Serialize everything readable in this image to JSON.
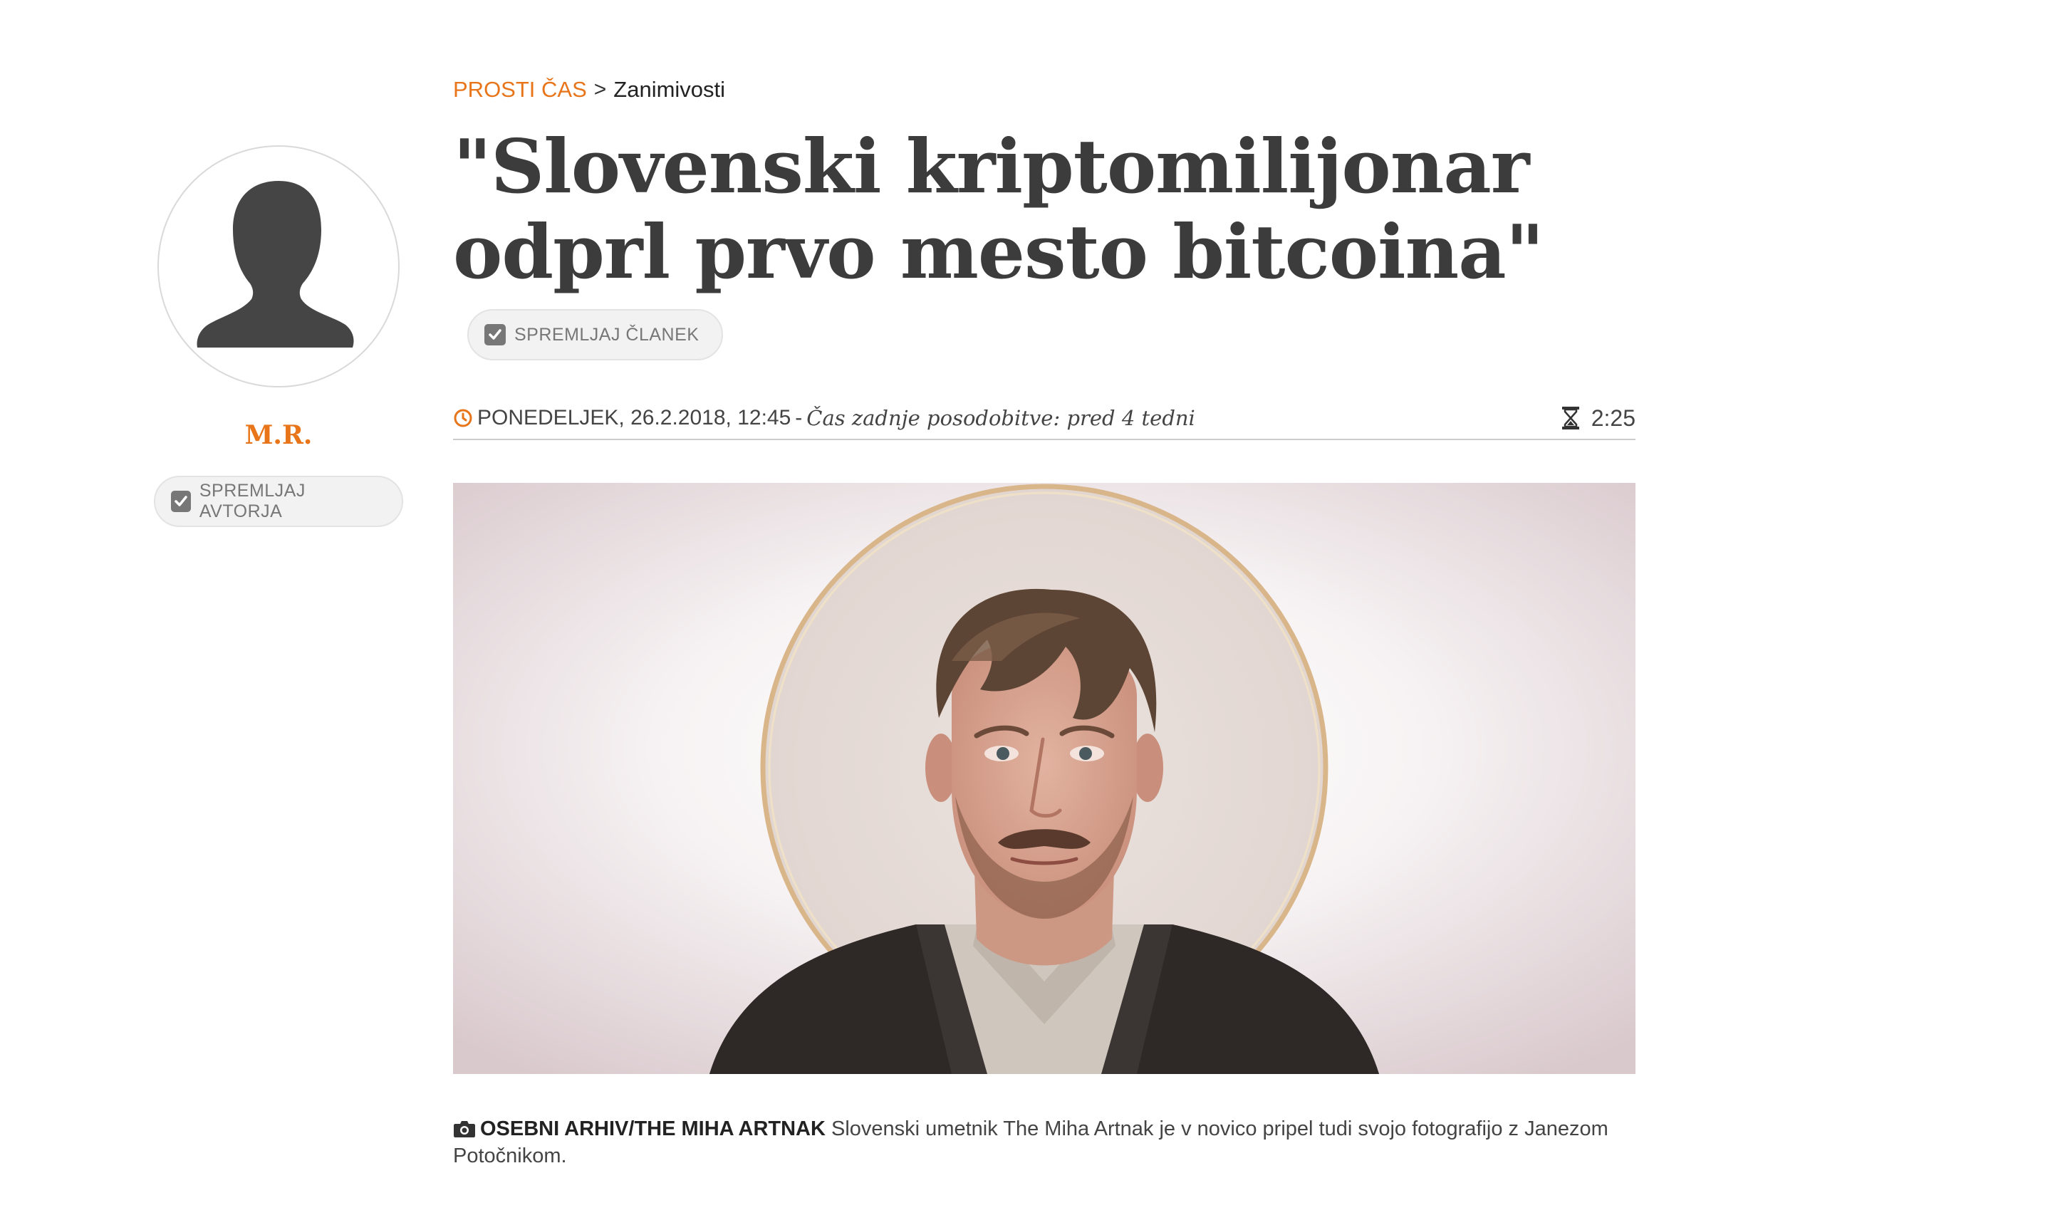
{
  "author": {
    "name": "M.R.",
    "avatar_icon": "person-silhouette-icon",
    "follow_label": "SPREMLJAJ AVTORJA"
  },
  "breadcrumb": {
    "section": "PROSTI ČAS",
    "separator": ">",
    "subsection": "Zanimivosti"
  },
  "article": {
    "title_line1": "\"Slovenski kriptomilijonar",
    "title_line2": "odprl prvo mesto bitcoina\"",
    "follow_label": "SPREMLJAJ ČLANEK",
    "date": "PONEDELJEK, 26.2.2018, 12:45",
    "date_separator": "-",
    "last_update": "Čas zadnje posodobitve: pred 4 tedni",
    "read_time": "2:25",
    "caption_credit": "OSEBNI ARHIV/THE MIHA ARTNAK",
    "caption_text": "Slovenski umetnik The Miha Artnak je v novico pripel tudi svojo fotografijo z Janezom Potočnikom."
  },
  "colors": {
    "accent": "#e8751a",
    "title": "#3c3c3c",
    "button_bg": "#f2f2f2"
  }
}
